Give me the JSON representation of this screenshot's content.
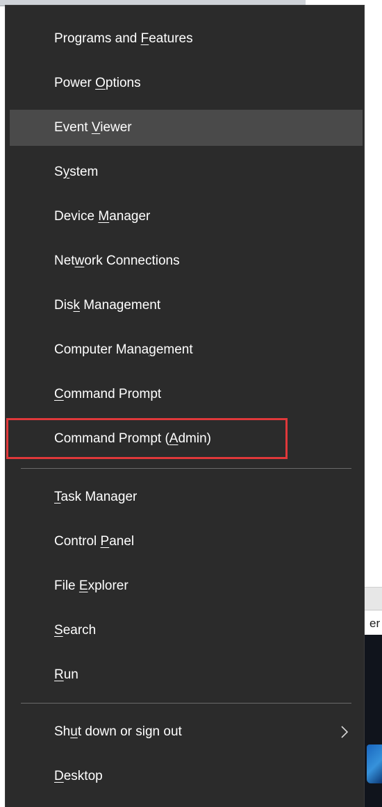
{
  "menu": {
    "items": [
      {
        "pre": "Programs and ",
        "key": "F",
        "post": "eatures"
      },
      {
        "pre": "Power ",
        "key": "O",
        "post": "ptions"
      },
      {
        "pre": "Event ",
        "key": "V",
        "post": "iewer"
      },
      {
        "pre": "S",
        "key": "y",
        "post": "stem"
      },
      {
        "pre": "Device ",
        "key": "M",
        "post": "anager"
      },
      {
        "pre": "Net",
        "key": "w",
        "post": "ork Connections"
      },
      {
        "pre": "Dis",
        "key": "k",
        "post": " Management"
      },
      {
        "pre": "Computer Mana",
        "key": "g",
        "post": "ement"
      },
      {
        "pre": "",
        "key": "C",
        "post": "ommand Prompt"
      },
      {
        "pre": "Command Prompt (",
        "key": "A",
        "post": "dmin)"
      },
      {
        "pre": "",
        "key": "T",
        "post": "ask Manager"
      },
      {
        "pre": "Control ",
        "key": "P",
        "post": "anel"
      },
      {
        "pre": "File ",
        "key": "E",
        "post": "xplorer"
      },
      {
        "pre": "",
        "key": "S",
        "post": "earch"
      },
      {
        "pre": "",
        "key": "R",
        "post": "un"
      },
      {
        "pre": "Sh",
        "key": "u",
        "post": "t down or sign out"
      },
      {
        "pre": "",
        "key": "D",
        "post": "esktop"
      }
    ],
    "hovered_item": "Event Viewer",
    "highlighted_item": "Command Prompt (Admin)",
    "submenu_icon": "chevron-right-icon"
  },
  "background": {
    "peek_text": "er"
  },
  "colors": {
    "menu_bg": "#2b2b2b",
    "hover_bg": "#4a4a4a",
    "text": "#ffffff",
    "separator": "#6a6a6a",
    "annotation_box": "#e0383a"
  }
}
